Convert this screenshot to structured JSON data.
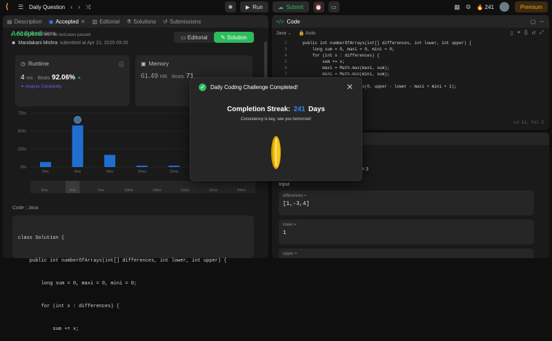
{
  "topbar": {
    "title": "Daily Question",
    "run_label": "Run",
    "submit_label": "Submit",
    "streak_count": "241",
    "premium_label": "Premium"
  },
  "left": {
    "tabs": [
      {
        "label": "Description"
      },
      {
        "label": "Accepted"
      },
      {
        "label": "Editorial"
      },
      {
        "label": "Solutions"
      },
      {
        "label": "Submissions"
      }
    ],
    "all_submissions": "All Submissions",
    "status": "Accepted",
    "testcases": "86 / 86 testcases passed",
    "author": "Mandakani Mishra",
    "submitted": "submitted at Apr 21, 2025 09:26",
    "editorial_btn": "Editorial",
    "solution_btn": "Solution",
    "runtime": {
      "label": "Runtime",
      "value": "4",
      "unit": "ms",
      "beats": "Beats",
      "pct": "92.06%"
    },
    "memory": {
      "label": "Memory",
      "value": "61.49",
      "unit": "MB",
      "beats": "Beats",
      "pct": "71"
    },
    "analyze": "Analyze Complexity",
    "code_label": "Code",
    "code_lang": "Java",
    "code_lines": [
      "class Solution {",
      "    public int numberOfArrays(int[] differences, int lower, int upper) {",
      "        long sum = 0, maxi = 0, mini = 0;",
      "        for (int x : differences) {",
      "            sum += x;"
    ]
  },
  "chart_data": {
    "type": "bar",
    "categories": [
      "2ms",
      "4ms",
      "6ms",
      "10ms",
      "12ms",
      "14ms",
      "21ms"
    ],
    "values": [
      7,
      58,
      17,
      2,
      2,
      2,
      2
    ],
    "ylim": [
      0,
      75
    ],
    "yticks": [
      "75%",
      "50%",
      "25%",
      "0%"
    ],
    "highlight": "4ms",
    "nav_labels": [
      "2ms",
      "4ms",
      "7ms",
      "10ms",
      "14ms",
      "21ms",
      "29ms",
      "44ms"
    ],
    "colors": {
      "bar": "#1f6fd1",
      "highlight": "#1f6fd1"
    }
  },
  "right": {
    "code_title": "Code",
    "lang": "Java",
    "auto": "Auto",
    "gutter": [
      "2",
      "3",
      "4",
      "5",
      "6",
      "7",
      "8",
      "9"
    ],
    "lines": [
      "    public int numberOfArrays(int[] differences, int lower, int upper) {",
      "        long sum = 0, maxi = 0, mini = 0;",
      "        for (int x : differences) {",
      "            sum += x;",
      "            maxi = Math.max(maxi, sum);",
      "            mini = Math.min(mini, sum);",
      "        }",
      "        return (int) Math.max(0, upper - lower - maxi + mini + 1);"
    ],
    "position": "Ln 11, Col 2"
  },
  "testcase": {
    "fragment": "= 3",
    "input_label": "Input",
    "cases": [
      {
        "name": "differences =",
        "value": "[1,-3,4]"
      },
      {
        "name": "lower =",
        "value": "1"
      },
      {
        "name": "upper =",
        "value": ""
      }
    ]
  },
  "modal": {
    "title": "Daily Coding Challenge Completed!",
    "streak_prefix": "Completion Streak:",
    "streak_value": "241",
    "streak_suffix": "Days",
    "message": "Consistency is key, see you tomorrow!"
  }
}
